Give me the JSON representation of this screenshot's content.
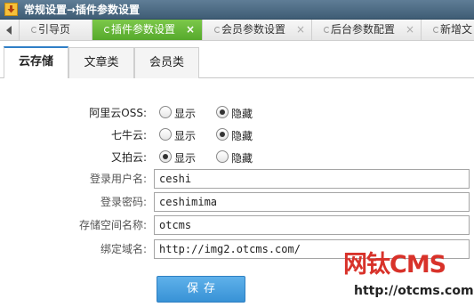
{
  "window": {
    "title": "常规设置→插件参数设置",
    "icon": "download-arrow-icon"
  },
  "tabs": [
    {
      "label": "引导页",
      "closable": false
    },
    {
      "label": "插件参数设置",
      "closable": true,
      "active": true
    },
    {
      "label": "会员参数设置",
      "closable": true
    },
    {
      "label": "后台参数配置",
      "closable": true
    },
    {
      "label": "新增文",
      "closable": false
    }
  ],
  "close_glyph": "×",
  "subtabs": [
    {
      "label": "云存储",
      "active": true
    },
    {
      "label": "文章类"
    },
    {
      "label": "会员类"
    }
  ],
  "form": {
    "radio_rows": [
      {
        "label": "阿里云OSS:",
        "options": [
          "显示",
          "隐藏"
        ],
        "selected": "隐藏"
      },
      {
        "label": "七牛云:",
        "options": [
          "显示",
          "隐藏"
        ],
        "selected": "隐藏"
      },
      {
        "label": "又拍云:",
        "options": [
          "显示",
          "隐藏"
        ],
        "selected": "显示"
      }
    ],
    "fields": [
      {
        "label": "登录用户名:",
        "value": "ceshi"
      },
      {
        "label": "登录密码:",
        "value": "ceshimima"
      },
      {
        "label": "存储空间名称:",
        "value": "otcms"
      },
      {
        "label": "绑定域名:",
        "value": "http://img2.otcms.com/"
      }
    ],
    "save_label": "保存"
  },
  "watermark": {
    "name": "网钛CMS",
    "url": "http://otcms.com"
  },
  "colors": {
    "titlebar": "#4a6a84",
    "active_tab": "#6bb83c",
    "subtab_accent": "#2f7fc7",
    "save_button": "#4aa2e2",
    "watermark_red": "#d8322a"
  }
}
